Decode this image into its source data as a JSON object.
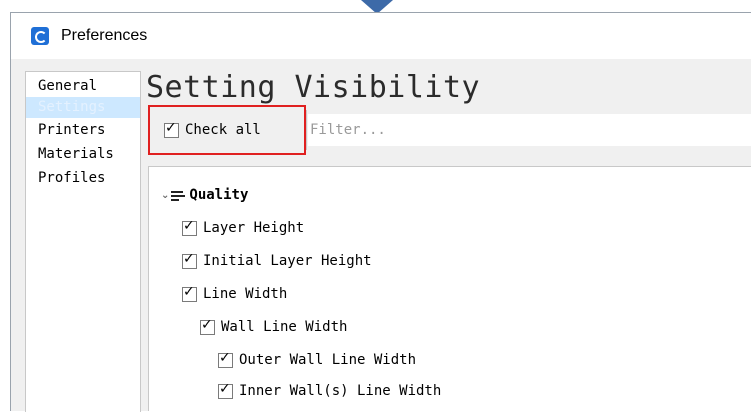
{
  "window": {
    "title": "Preferences"
  },
  "sidebar": {
    "items": [
      {
        "label": "General",
        "selected": false
      },
      {
        "label": "Settings",
        "selected": true
      },
      {
        "label": "Printers",
        "selected": false
      },
      {
        "label": "Materials",
        "selected": false
      },
      {
        "label": "Profiles",
        "selected": false
      }
    ]
  },
  "main": {
    "heading": "Setting Visibility",
    "check_all": {
      "label": "Check all",
      "checked": true
    },
    "filter": {
      "placeholder": "Filter...",
      "value": ""
    },
    "category": {
      "label": "Quality",
      "expanded": true,
      "icon": "quality-icon"
    },
    "settings": [
      {
        "label": "Layer Height",
        "checked": true
      },
      {
        "label": "Initial Layer Height",
        "checked": true
      },
      {
        "label": "Line Width",
        "checked": true
      },
      {
        "label": "Wall Line Width",
        "checked": true
      },
      {
        "label": "Outer Wall Line Width",
        "checked": true
      },
      {
        "label": "Inner Wall(s) Line Width",
        "checked": true
      }
    ]
  },
  "colors": {
    "highlight": "#e02020",
    "selection": "#cde8ff",
    "arrow": "#3d6aa8"
  }
}
